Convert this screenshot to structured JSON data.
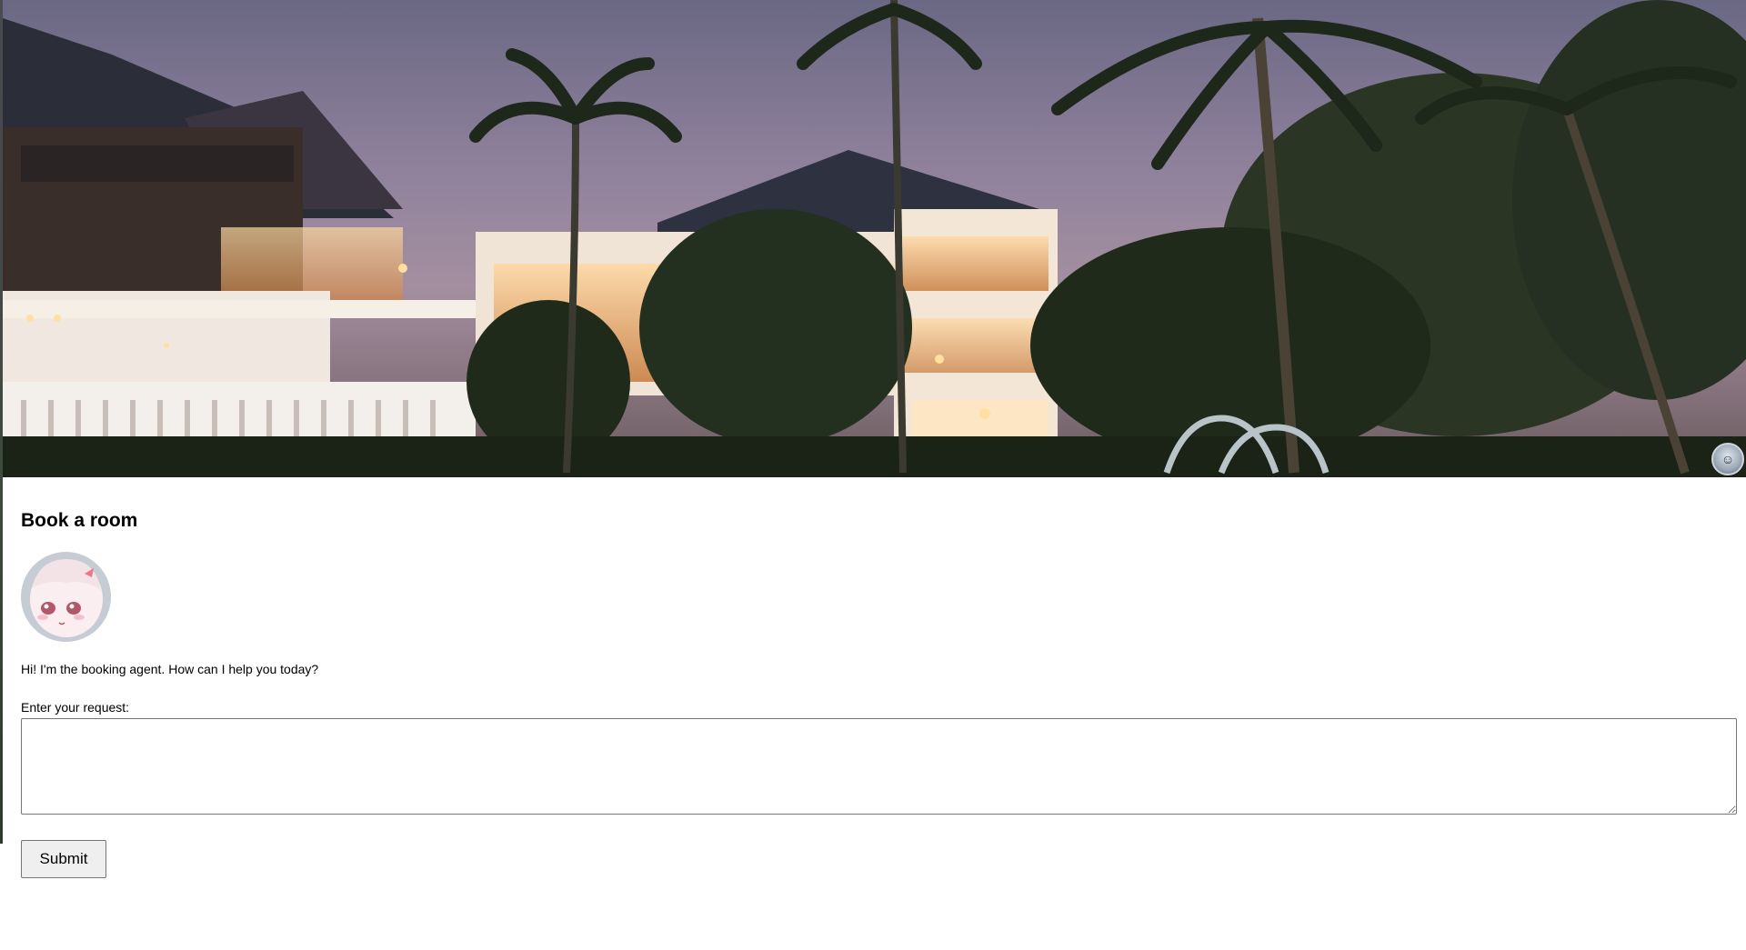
{
  "hero": {
    "image_alt": "Resort at dusk with palm trees"
  },
  "booking": {
    "title": "Book a room",
    "greeting": "Hi! I'm the booking agent. How can I help you today?",
    "request_label": "Enter your request:",
    "request_value": "",
    "submit_label": "Submit"
  },
  "colors": {
    "sky_top": "#6e6a85",
    "sky_mid": "#a08da0",
    "building_light": "#f2c38a",
    "foliage": "#1f2a1a"
  }
}
